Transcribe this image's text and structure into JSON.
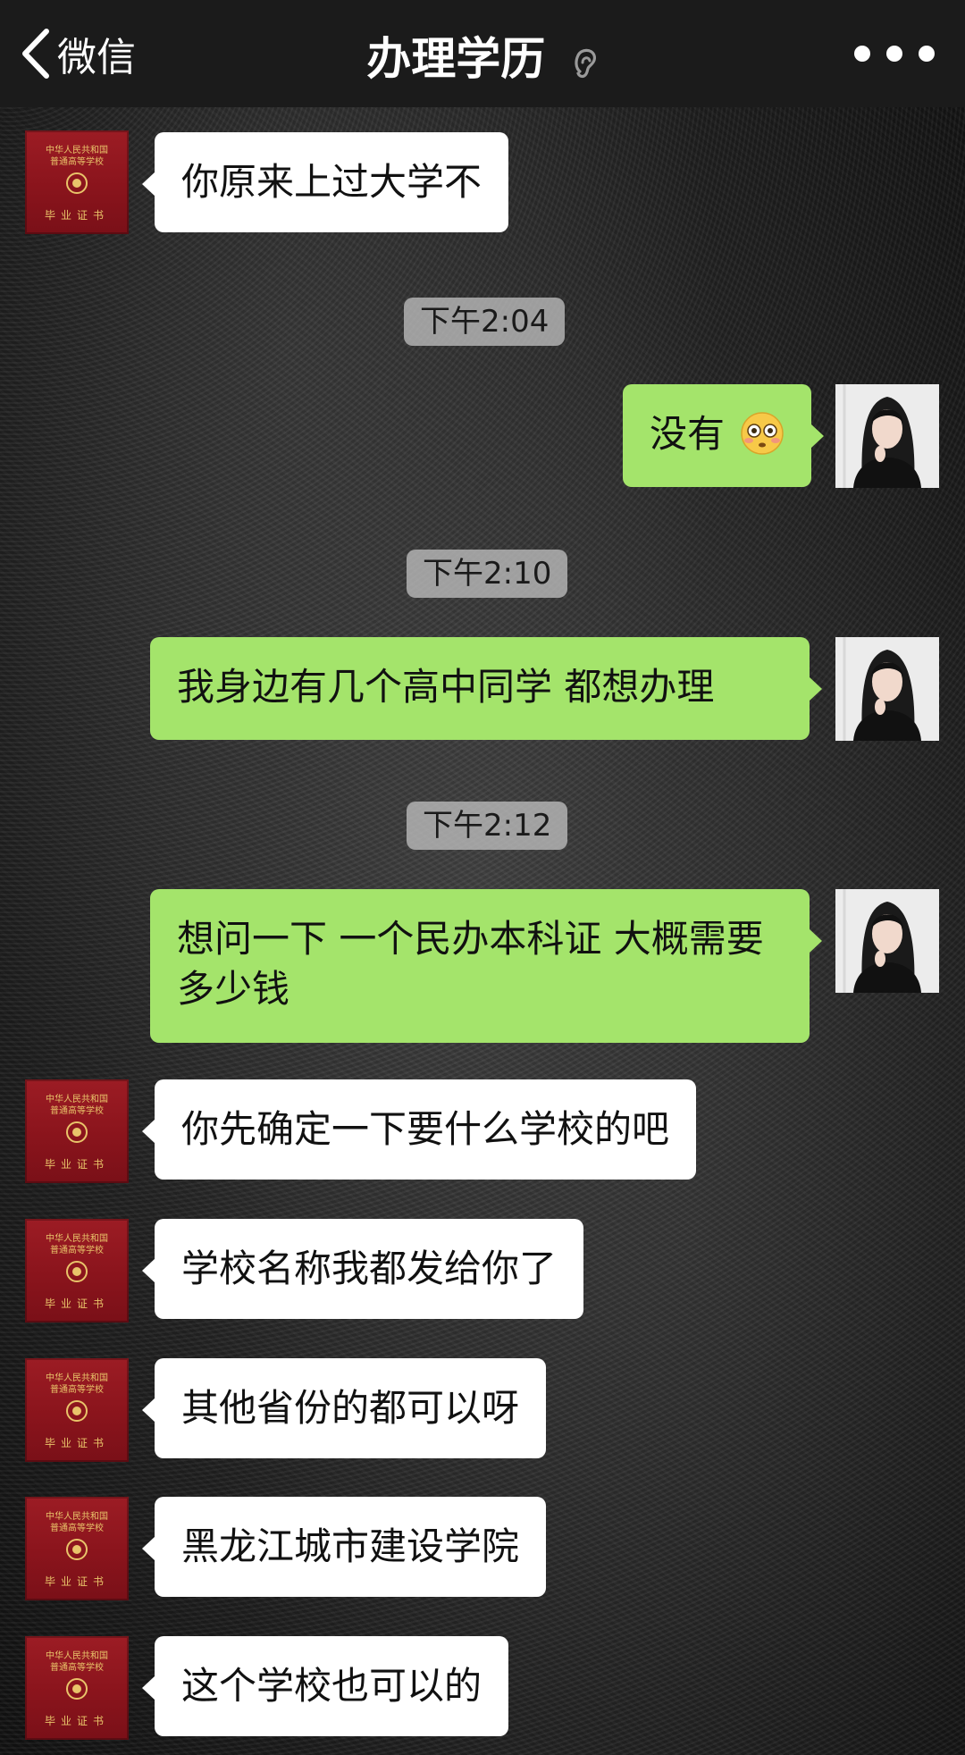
{
  "nav": {
    "back_label": "微信",
    "title": "办理学历"
  },
  "certificate_avatar": {
    "top_text": "中华人民共和国\n普通高等学校",
    "bottom_text": "毕业证书"
  },
  "messages": [
    {
      "side": "left",
      "text": "你原来上过大学不"
    },
    {
      "side": "right",
      "text": "没有",
      "emoji": "flushed-face-emoji"
    },
    {
      "side": "right",
      "text": "我身边有几个高中同学 都想办理"
    },
    {
      "side": "right",
      "text": "想问一下 一个民办本科证 大概需要多少钱"
    },
    {
      "side": "left",
      "text": "你先确定一下要什么学校的吧"
    },
    {
      "side": "left",
      "text": "学校名称我都发给你了"
    },
    {
      "side": "left",
      "text": "其他省份的都可以呀"
    },
    {
      "side": "left",
      "text": "黑龙江城市建设学院"
    },
    {
      "side": "left",
      "text": "这个学校也可以的"
    }
  ],
  "timestamps": [
    "下午2:04",
    "下午2:10",
    "下午2:12"
  ],
  "colors": {
    "sent_bubble": "#a4e46b",
    "received_bubble": "#ffffff",
    "nav_background": "#1b1b1b"
  }
}
